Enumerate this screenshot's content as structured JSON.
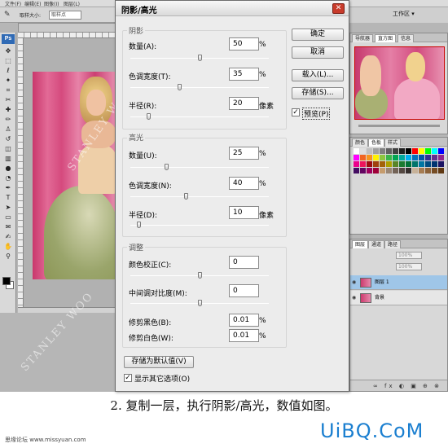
{
  "dialog": {
    "title": "阴影/高光",
    "close_icon": "close-icon",
    "shadows": {
      "group_title": "阴影",
      "amount_label": "数量(A):",
      "amount_value": "50",
      "amount_unit": "%",
      "amount_level": 0.5,
      "tonal_label": "色调宽度(T):",
      "tonal_value": "35",
      "tonal_unit": "%",
      "tonal_level": 0.35,
      "radius_label": "半径(R):",
      "radius_value": "20",
      "radius_unit": "像素",
      "radius_level": 0.12
    },
    "highlights": {
      "group_title": "高光",
      "amount_label": "数量(U):",
      "amount_value": "25",
      "amount_unit": "%",
      "amount_level": 0.25,
      "tonal_label": "色调宽度(N):",
      "tonal_value": "40",
      "tonal_unit": "%",
      "tonal_level": 0.4,
      "radius_label": "半径(D):",
      "radius_value": "10",
      "radius_unit": "像素",
      "radius_level": 0.05
    },
    "adjustments": {
      "group_title": "调整",
      "color_label": "颜色校正(C):",
      "color_value": "0",
      "color_level": 0.5,
      "midtone_label": "中间调对比度(M):",
      "midtone_value": "0",
      "midtone_level": 0.5,
      "black_clip_label": "修剪黑色(B):",
      "black_clip_value": "0.01",
      "black_clip_unit": "%",
      "white_clip_label": "修剪白色(W):",
      "white_clip_value": "0.01",
      "white_clip_unit": "%"
    },
    "buttons": {
      "ok": "确定",
      "cancel": "取消",
      "load": "载入(L)...",
      "save": "存储(S)...",
      "save_default": "存储为默认值(V)"
    },
    "preview_label": "预览(P)",
    "preview_checked": true,
    "more_options_label": "显示其它选项(O)",
    "more_options_checked": true,
    "check_glyph": "✓"
  },
  "workspace": {
    "menu_items": [
      "文件(F)",
      "编辑(E)",
      "图像(I)",
      "图层(L)"
    ],
    "options_label": "取样大小:",
    "options_value": "取样点",
    "workspace_button": "工作区 ▾",
    "nav_tabs": [
      "导航器",
      "直方图",
      "信息"
    ],
    "swatch_tabs": [
      "颜色",
      "色板",
      "样式"
    ],
    "layer_tabs": [
      "图层",
      "通道",
      "路径"
    ],
    "opacity_value": "100%",
    "fill_value": "100%",
    "layers": [
      {
        "name": "图层 1"
      },
      {
        "name": "背景"
      }
    ],
    "layer_footer": "∞ fx ◐ ▣ ⊕ ⊗",
    "watermark": "STANLEY WOO",
    "swatch_colors": [
      "#ffffff",
      "#e0e0e0",
      "#c0c0c0",
      "#a0a0a0",
      "#808080",
      "#606060",
      "#404040",
      "#202020",
      "#000000",
      "#ff0000",
      "#ffff00",
      "#00ff00",
      "#00ffff",
      "#0000ff",
      "#ff00ff",
      "#f26522",
      "#f7941d",
      "#fff200",
      "#8dc63f",
      "#39b54a",
      "#00a651",
      "#00a99d",
      "#00aeef",
      "#0072bc",
      "#0054a6",
      "#2e3192",
      "#662d91",
      "#92278f",
      "#ec008c",
      "#ed145b",
      "#9e0b0f",
      "#a0410d",
      "#a36209",
      "#aba000",
      "#598527",
      "#1a7b30",
      "#007236",
      "#00746b",
      "#0076a3",
      "#004b80",
      "#003471",
      "#1b1464",
      "#440e62",
      "#630460",
      "#9e005d",
      "#9e0039",
      "#c69c6d",
      "#998675",
      "#736357",
      "#534741",
      "#362f2d",
      "#c7b299",
      "#a67c52",
      "#8c6239",
      "#754c24",
      "#603913"
    ]
  },
  "caption": "2. 复制一层，执行阴影/高光，数值如图。",
  "footer_left": "思缘论坛 www.missyuan.com",
  "footer_logo": "UiBQ.CoM"
}
